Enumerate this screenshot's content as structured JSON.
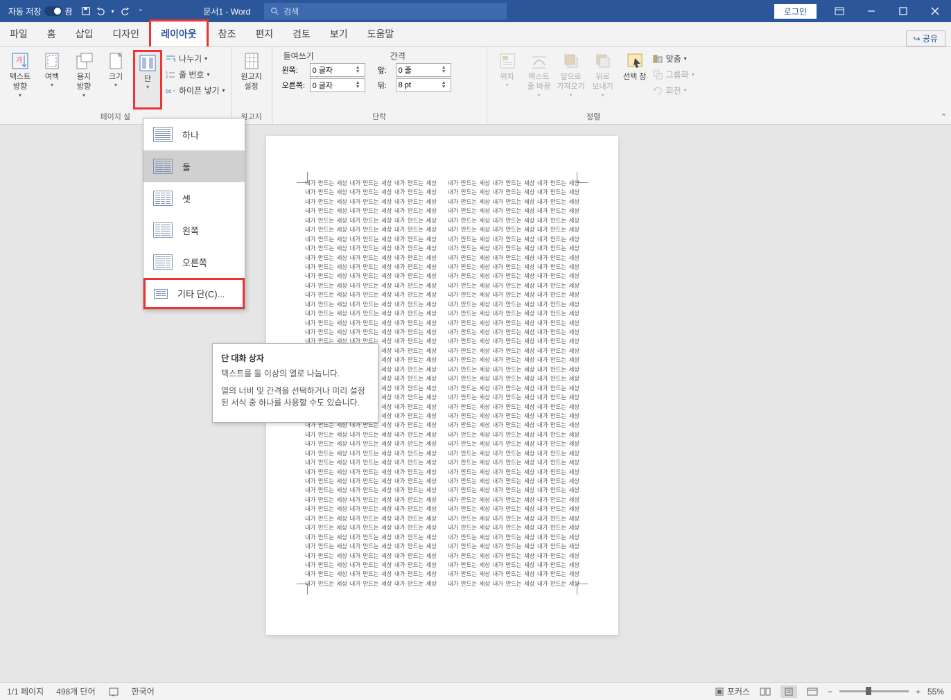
{
  "titlebar": {
    "autosave_label": "자동 저장",
    "autosave_state": "끔",
    "doc_title": "문서1 - Word",
    "search_placeholder": "검색",
    "login": "로그인"
  },
  "tabs": {
    "file": "파일",
    "home": "홈",
    "insert": "삽입",
    "design": "디자인",
    "layout": "레이아웃",
    "references": "참조",
    "mailings": "편지",
    "review": "검토",
    "view": "보기",
    "help": "도움말",
    "share": "공유"
  },
  "ribbon": {
    "page_setup": {
      "text_direction": "텍스트\n방향",
      "margins": "여백",
      "orientation": "용지\n방향",
      "size": "크기",
      "columns": "단",
      "breaks": "나누기",
      "line_numbers": "줄 번호",
      "hyphenation": "하이픈 넣기",
      "group_label": "페이지 설"
    },
    "manuscript": {
      "settings": "원고지\n설정",
      "group_label": "원고지"
    },
    "paragraph": {
      "indent_label": "들여쓰기",
      "spacing_label": "간격",
      "left_label": "왼쪽:",
      "right_label": "오른쪽:",
      "before_label": "앞:",
      "after_label": "뒤:",
      "left_val": "0 글자",
      "right_val": "0 글자",
      "before_val": "0 줄",
      "after_val": "8 pt",
      "group_label": "단락"
    },
    "arrange": {
      "position": "위치",
      "wrap": "텍스트\n줄 바꿈",
      "bring_forward": "앞으로\n가져오기",
      "send_backward": "뒤로\n보내기",
      "selection_pane": "선택 창",
      "align": "맞춤",
      "group": "그룹화",
      "rotate": "회전",
      "group_label": "정렬"
    }
  },
  "columns_menu": {
    "one": "하나",
    "two": "둘",
    "three": "셋",
    "left": "왼쪽",
    "right": "오른쪽",
    "more": "기타 단(C)..."
  },
  "tooltip": {
    "title": "단 대화 상자",
    "line1": "텍스트를 둘 이상의 열로 나눕니다.",
    "line2": "열의 너비 및 간격을 선택하거나 미리 설정된 서식 중 하나를 사용할 수도 있습니다."
  },
  "document": {
    "repeat_text": "내가 만드는 세상 "
  },
  "statusbar": {
    "page": "1/1 페이지",
    "words": "498개 단어",
    "language": "한국어",
    "focus": "포커스",
    "zoom": "55%"
  }
}
